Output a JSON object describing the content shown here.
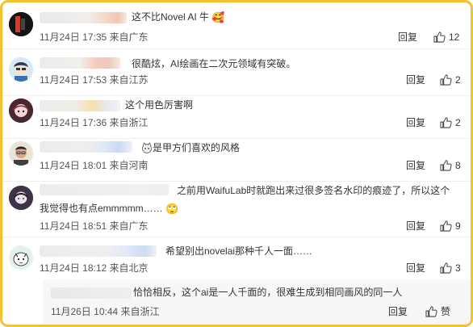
{
  "comments": [
    {
      "text": "这不比Novel AI 牛",
      "emoji": "🥰",
      "date": "11月24日 17:35",
      "location": "来自广东",
      "reply_label": "回复",
      "likes": "12",
      "avatar_icon": "avatar-dark-icon"
    },
    {
      "text": "很酷炫，AI绘画在二次元领域有突破。",
      "date": "11月24日 17:53",
      "location": "来自江苏",
      "reply_label": "回复",
      "likes": "2",
      "avatar_icon": "avatar-anime-icon"
    },
    {
      "text": "这个用色厉害啊",
      "date": "11月24日 17:36",
      "location": "来自浙江",
      "reply_label": "回复",
      "likes": "2",
      "avatar_icon": "avatar-girl-icon"
    },
    {
      "text": "是甲方们喜欢的风格",
      "date": "11月24日 18:01",
      "location": "来自河南",
      "reply_label": "回复",
      "likes": "8",
      "avatar_icon": "avatar-man-icon"
    },
    {
      "text_line1": "之前用WaifuLab时就跑出来过很多签名水印的痕迹了，所以这个",
      "text_line2": "我觉得也有点emmmmm……",
      "emoji": "🙄",
      "date": "11月24日 18:51",
      "location": "来自广东",
      "reply_label": "回复",
      "likes": "9",
      "avatar_icon": "avatar-anime-dark-icon"
    },
    {
      "text": "希望别出novelai那种千人一面……",
      "date": "11月24日 18:12",
      "location": "来自北京",
      "reply_label": "回复",
      "likes": "3",
      "avatar_icon": "avatar-cartoon-icon"
    }
  ],
  "sub_reply": {
    "text": "恰恰相反，这个ai是一人千面的，很难生成到相同画风的同一人",
    "date": "11月26日 10:44",
    "location": "来自浙江",
    "reply_label": "回复",
    "likes": "赞"
  },
  "colors": {
    "border": "#f2c230",
    "divider": "#eeeeee",
    "sub_panel": "#f7f7f7"
  }
}
